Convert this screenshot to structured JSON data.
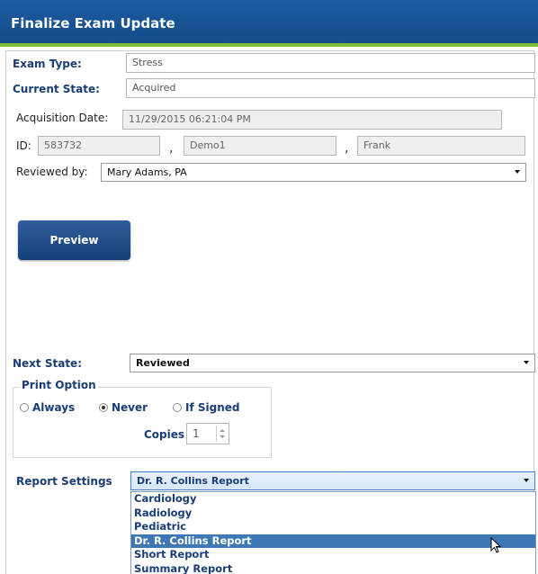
{
  "dialog": {
    "title": "Finalize Exam Update"
  },
  "form": {
    "exam_type_label": "Exam Type:",
    "exam_type_value": "Stress",
    "current_state_label": "Current State:",
    "current_state_value": "Acquired",
    "acquisition_date_label": "Acquisition Date:",
    "acquisition_date_value": "11/29/2015 06:21:04 PM",
    "id_label": "ID:",
    "id_value": "583732",
    "last_name_value": "Demo1",
    "first_name_value": "Frank",
    "separator": ",",
    "reviewed_by_label": "Reviewed by:",
    "reviewed_by_value": "Mary Adams, PA"
  },
  "buttons": {
    "preview_label": "Preview"
  },
  "next_state": {
    "label": "Next State:",
    "value": "Reviewed"
  },
  "print_option": {
    "legend": "Print Option",
    "options": [
      {
        "label": "Always",
        "selected": false
      },
      {
        "label": "Never",
        "selected": true
      },
      {
        "label": "If Signed",
        "selected": false
      }
    ],
    "copies_label": "Copies",
    "copies_value": "1"
  },
  "report_settings": {
    "label": "Report Settings",
    "value": "Dr. R. Collins Report",
    "options": [
      "Cardiology",
      "Radiology",
      "Pediatric",
      "Dr. R. Collins Report",
      "Short Report",
      "Summary Report"
    ],
    "highlighted_index": 3
  },
  "colors": {
    "title_bar": "#1c5ba0",
    "accent_bar": "#7fbf3a",
    "label_blue": "#1a3d78",
    "selection": "#3d78b5"
  },
  "icons": {
    "dropdown_arrow": "chevron-down-icon",
    "cursor": "mouse-pointer-icon"
  }
}
